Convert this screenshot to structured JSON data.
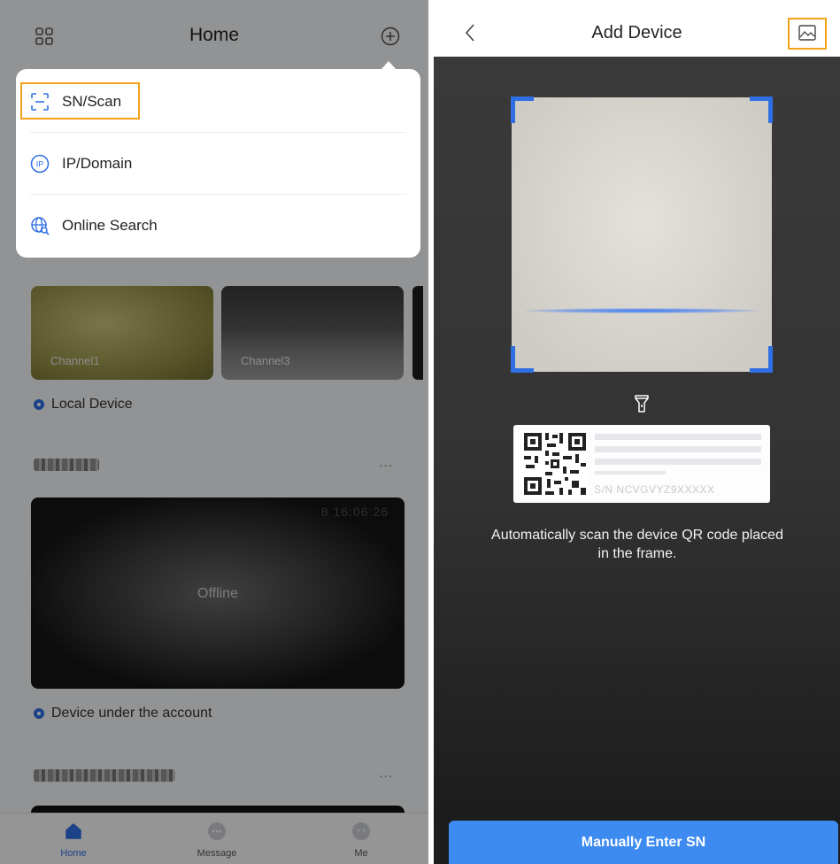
{
  "left": {
    "title": "Home",
    "popup": {
      "items": [
        {
          "label": "SN/Scan",
          "icon": "scan-icon"
        },
        {
          "label": "IP/Domain",
          "icon": "ip-icon"
        },
        {
          "label": "Online Search",
          "icon": "globe-search-icon"
        }
      ]
    },
    "local_device": {
      "title": "Local Device",
      "channels": [
        {
          "label": "Channel1"
        },
        {
          "label": "Channel3"
        }
      ]
    },
    "account": {
      "title": "Device under the account",
      "video_status": "Offline",
      "osd_time": "8 16:06:26",
      "more": "..."
    },
    "tabs": [
      {
        "label": "Home",
        "icon": "home-icon",
        "active": true
      },
      {
        "label": "Message",
        "icon": "message-icon",
        "active": false
      },
      {
        "label": "Me",
        "icon": "me-icon",
        "active": false
      }
    ]
  },
  "right": {
    "title": "Add Device",
    "label_sn": "S/N  NCVGVYZ9XXXXX",
    "hint": "Automatically scan the device QR code placed in the frame.",
    "manual_button": "Manually Enter SN"
  },
  "colors": {
    "accent": "#2f6fe4",
    "highlight": "#f2a21a",
    "button": "#3d8bf0"
  }
}
